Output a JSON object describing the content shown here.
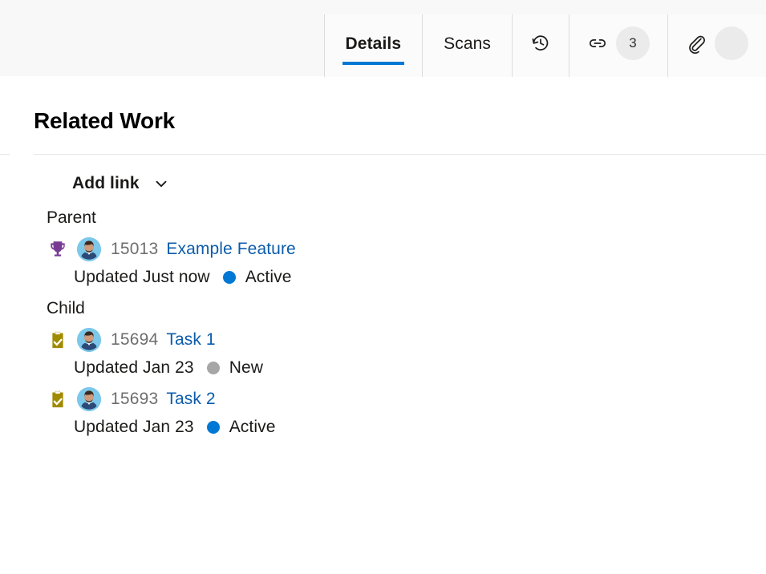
{
  "header": {
    "tabs": [
      {
        "label": "Details",
        "icon": "",
        "badge": "",
        "active": true,
        "type": "text"
      },
      {
        "label": "Scans",
        "icon": "",
        "badge": "",
        "active": false,
        "type": "text"
      },
      {
        "label": "",
        "icon": "history-icon",
        "badge": "",
        "active": false,
        "type": "icon"
      },
      {
        "label": "",
        "icon": "link-icon",
        "badge": "3",
        "active": false,
        "type": "icon"
      },
      {
        "label": "",
        "icon": "attachment-icon",
        "badge": "",
        "active": false,
        "type": "icon"
      }
    ]
  },
  "main": {
    "section_title": "Related Work",
    "add_link_label": "Add link",
    "groups": [
      {
        "label": "Parent",
        "items": [
          {
            "type_icon": "feature-trophy-icon",
            "type_color": "#773b93",
            "avatar": "bearded-man-avatar",
            "id": "15013",
            "title": "Example Feature",
            "updated": "Updated Just now",
            "state": "Active",
            "state_color": "#0078d4"
          }
        ]
      },
      {
        "label": "Child",
        "items": [
          {
            "type_icon": "task-clipboard-icon",
            "type_color": "#a08a00",
            "avatar": "bearded-man-avatar",
            "id": "15694",
            "title": "Task 1",
            "updated": "Updated Jan 23",
            "state": "New",
            "state_color": "#a6a6a6"
          },
          {
            "type_icon": "task-clipboard-icon",
            "type_color": "#a08a00",
            "avatar": "bearded-man-avatar",
            "id": "15693",
            "title": "Task 2",
            "updated": "Updated Jan 23",
            "state": "Active",
            "state_color": "#0078d4"
          }
        ]
      }
    ]
  },
  "colors": {
    "accent": "#0078d4",
    "link": "#0b5cab",
    "feature": "#773b93",
    "task": "#a08a00",
    "state_new": "#a6a6a6",
    "header_bg": "#f8f8f8"
  }
}
